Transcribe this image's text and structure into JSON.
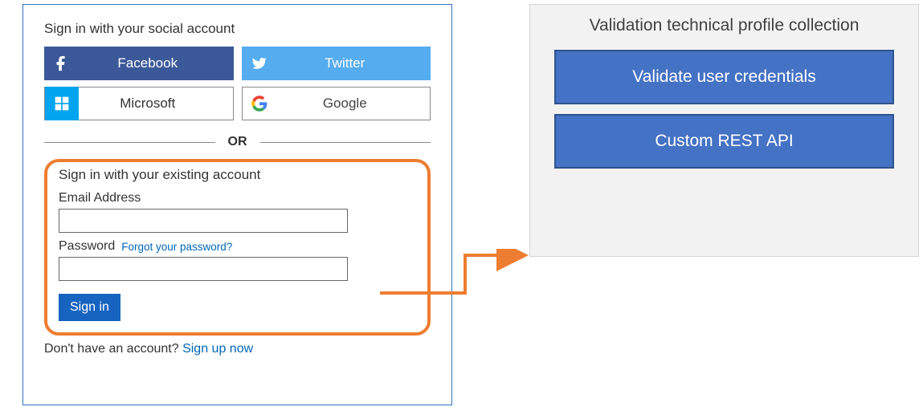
{
  "signin": {
    "social_heading": "Sign in with your social account",
    "buttons": {
      "facebook": "Facebook",
      "twitter": "Twitter",
      "microsoft": "Microsoft",
      "google": "Google"
    },
    "or_label": "OR",
    "form_heading": "Sign in with your existing account",
    "email_label": "Email Address",
    "email_value": "",
    "password_label": "Password",
    "password_value": "",
    "forgot_label": "Forgot your password?",
    "signin_button": "Sign in",
    "signup_prompt": "Don't have an account?",
    "signup_link": "Sign up now"
  },
  "validation": {
    "title": "Validation technical profile collection",
    "items": [
      "Validate user credentials",
      "Custom REST API"
    ]
  },
  "colors": {
    "accent_orange": "#ed7d31",
    "box_blue": "#4472c4",
    "panel_border": "#2f74c1"
  }
}
